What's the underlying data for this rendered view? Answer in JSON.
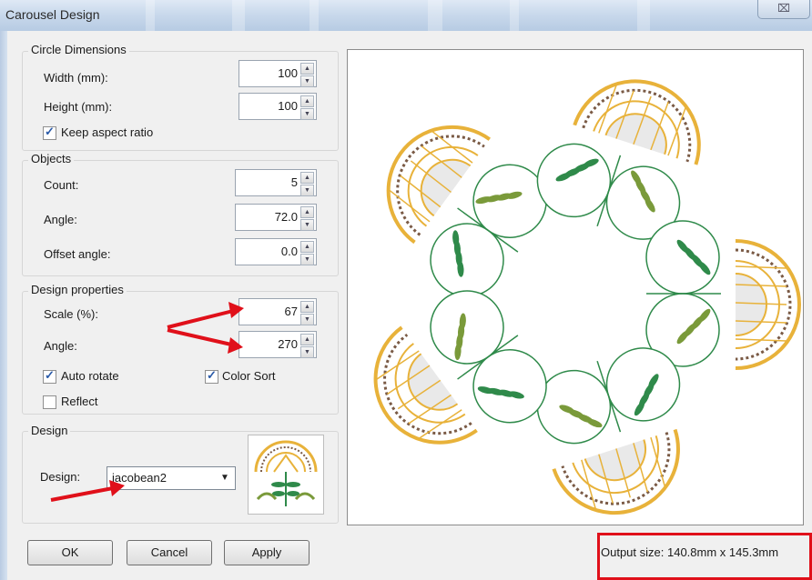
{
  "window": {
    "title": "Carousel Design",
    "close_glyph": "⌧"
  },
  "circle_dimensions": {
    "title": "Circle Dimensions",
    "width_label": "Width (mm):",
    "width_value": "100",
    "height_label": "Height (mm):",
    "height_value": "100",
    "keep_aspect_label": "Keep aspect ratio",
    "keep_aspect_checked": true
  },
  "objects": {
    "title": "Objects",
    "count_label": "Count:",
    "count_value": "5",
    "angle_label": "Angle:",
    "angle_value": "72.0",
    "offset_label": "Offset angle:",
    "offset_value": "0.0"
  },
  "design_properties": {
    "title": "Design properties",
    "scale_label": "Scale (%):",
    "scale_value": "67",
    "angle_label": "Angle:",
    "angle_value": "270",
    "auto_rotate_label": "Auto rotate",
    "auto_rotate_checked": true,
    "color_sort_label": "Color Sort",
    "color_sort_checked": true,
    "reflect_label": "Reflect",
    "reflect_checked": false
  },
  "design": {
    "title": "Design",
    "design_label": "Design:",
    "design_value": "jacobean2"
  },
  "buttons": {
    "ok": "OK",
    "cancel": "Cancel",
    "apply": "Apply"
  },
  "status": {
    "output_size": "Output size: 140.8mm x 145.3mm"
  },
  "colors": {
    "annotation_red": "#e0101a",
    "embroidery_gold": "#e8b23a",
    "embroidery_green": "#2f8a4a",
    "embroidery_brown": "#7a5a45"
  },
  "icons": {
    "spin_up": "spin-up-arrow-icon",
    "spin_down": "spin-down-arrow-icon",
    "combo": "chevron-down-icon",
    "checkbox": "check-icon"
  }
}
